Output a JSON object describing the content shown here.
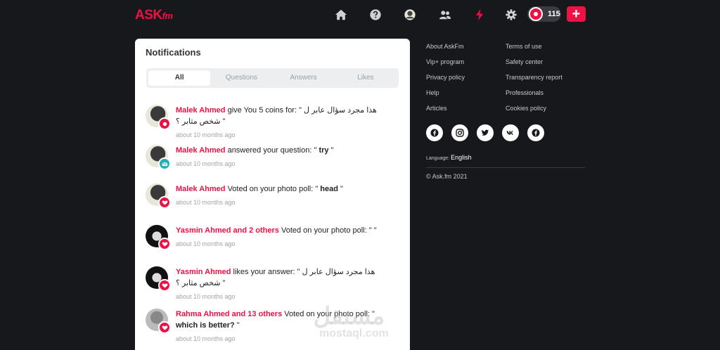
{
  "header": {
    "logo_main": "ASK",
    "logo_suffix": "fm",
    "coins": "115",
    "plus_label": "+",
    "nav_icons": [
      "home-icon",
      "help-icon",
      "profile-icon",
      "friends-icon",
      "lightning-icon",
      "gear-icon"
    ],
    "accent": "#ee1144"
  },
  "notifications": {
    "title": "Notifications",
    "tabs": [
      "All",
      "Questions",
      "Answers",
      "Likes"
    ],
    "active_tab": "All",
    "items": [
      {
        "who": "Malek Ahmed",
        "text": " give You 5 coins for: \" هذا مجرد سؤال عابر ل شخص مثابر ؟ \"",
        "bold": "",
        "tail": "",
        "time": "about 10 months ago",
        "badge": "coin-icon"
      },
      {
        "who": "Malek Ahmed",
        "text": " answered your question: \" ",
        "bold": "try",
        "tail": " \"",
        "time": "about 10 months ago",
        "badge": "mail-icon"
      },
      {
        "who": "Malek Ahmed",
        "text": " Voted on your photo poll: \" ",
        "bold": "head",
        "tail": " \"",
        "time": "about 10 months ago",
        "badge": "heart-icon"
      },
      {
        "who": "Yasmin Ahmed and 2 others",
        "text": " Voted on your photo poll: \" \"",
        "bold": "",
        "tail": "",
        "time": "about 10 months ago",
        "badge": "heart-icon"
      },
      {
        "who": "Yasmin Ahmed",
        "text": " likes your answer: \" هذا مجرد سؤال عابر ل شخص مثابر ؟ \"",
        "bold": "",
        "tail": "",
        "time": "about 10 months ago",
        "badge": "heart-icon"
      },
      {
        "who": "Rahma Ahmed and 13 others",
        "text": " Voted on your photo poll: \" ",
        "bold": "which is better?",
        "tail": " \"",
        "time": "about 10 months ago",
        "badge": "heart-icon"
      }
    ]
  },
  "footer": {
    "links_left": [
      "About AskFm",
      "Vip+ program",
      "Privacy policy",
      "Help",
      "Articles"
    ],
    "links_right": [
      "Terms of use",
      "Safety center",
      "Transparency report",
      "Professionals",
      "Cookies policy"
    ],
    "social": [
      "facebook-icon",
      "instagram-icon",
      "twitter-icon",
      "vk-icon",
      "facebook-icon"
    ],
    "language_label": "Language:",
    "language_value": "English",
    "copyright": "© Ask.fm 2021"
  },
  "watermark": {
    "arabic": "مستقل",
    "latin": "mostaql.com"
  }
}
